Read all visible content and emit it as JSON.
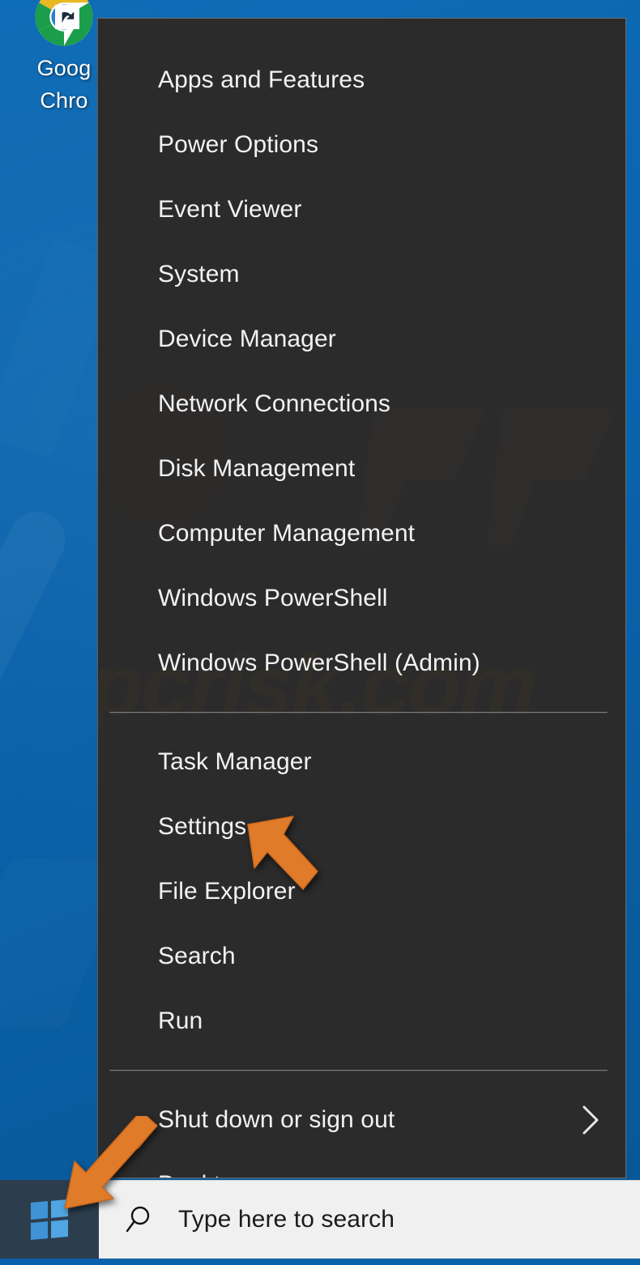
{
  "desktop": {
    "icon": {
      "name": "google-chrome-shortcut",
      "label_line1": "Goog",
      "label_line2": "Chro"
    },
    "background_color": "#0a62ab"
  },
  "winx_menu": {
    "background_color": "#2b2b2b",
    "watermark_text": "pcrisk.com",
    "groups": [
      {
        "items": [
          {
            "label": "Apps and Features"
          },
          {
            "label": "Power Options"
          },
          {
            "label": "Event Viewer"
          },
          {
            "label": "System"
          },
          {
            "label": "Device Manager"
          },
          {
            "label": "Network Connections"
          },
          {
            "label": "Disk Management"
          },
          {
            "label": "Computer Management"
          },
          {
            "label": "Windows PowerShell"
          },
          {
            "label": "Windows PowerShell (Admin)"
          }
        ]
      },
      {
        "items": [
          {
            "label": "Task Manager"
          },
          {
            "label": "Settings"
          },
          {
            "label": "File Explorer"
          },
          {
            "label": "Search"
          },
          {
            "label": "Run"
          }
        ]
      },
      {
        "items": [
          {
            "label": "Shut down or sign out",
            "submenu": true,
            "submenu_icon": "chevron-right-icon"
          },
          {
            "label": "Desktop"
          }
        ]
      }
    ]
  },
  "annotations": {
    "color": "#e07b2a",
    "arrows": [
      {
        "name": "arrow-pointing-to-settings",
        "points_at": "Settings"
      },
      {
        "name": "arrow-pointing-to-start-button",
        "points_at": "Start"
      }
    ]
  },
  "taskbar": {
    "start_button": {
      "name": "start-button",
      "icon": "windows-logo-icon"
    },
    "search": {
      "icon": "search-icon",
      "placeholder": "Type here to search",
      "value": ""
    }
  }
}
